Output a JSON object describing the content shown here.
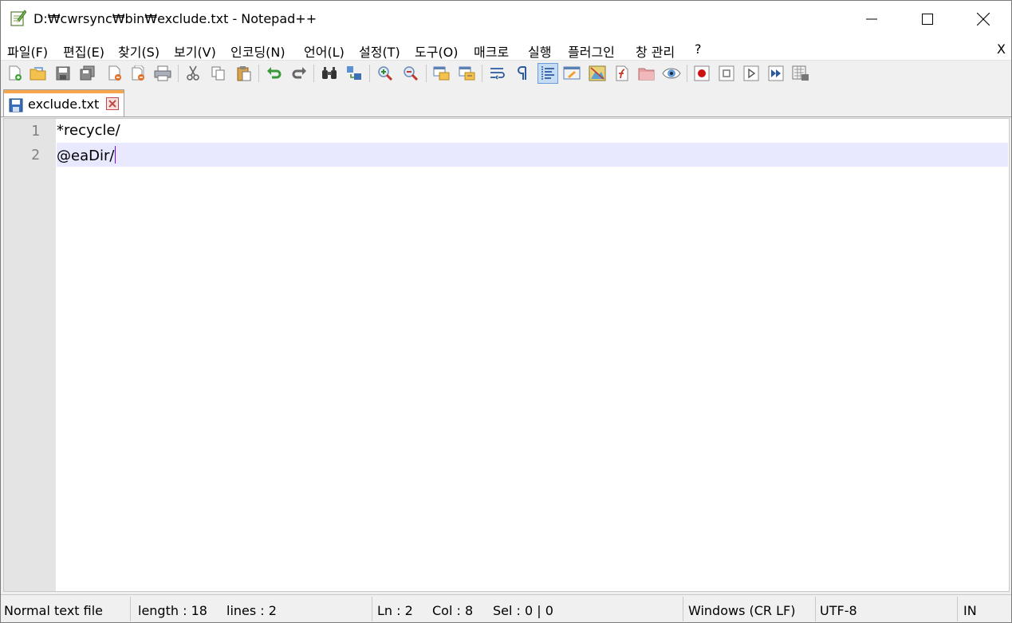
{
  "window": {
    "title": "D:₩cwrsync₩bin₩exclude.txt - Notepad++"
  },
  "menu": {
    "items": [
      "파일(F)",
      "편집(E)",
      "찾기(S)",
      "보기(V)",
      "인코딩(N)",
      "언어(L)",
      "설정(T)",
      "도구(O)",
      "매크로",
      "실행",
      "플러그인",
      "창 관리",
      "?"
    ],
    "close_label": "X"
  },
  "toolbar": {
    "icons": [
      "new-file-icon",
      "open-file-icon",
      "save-icon",
      "save-all-icon",
      "close-icon",
      "close-all-icon",
      "print-icon",
      "cut-icon",
      "copy-icon",
      "paste-icon",
      "undo-icon",
      "redo-icon",
      "find-icon",
      "replace-icon",
      "zoom-in-icon",
      "zoom-out-icon",
      "sync-vertical-icon",
      "sync-horizontal-icon",
      "word-wrap-icon",
      "show-all-chars-icon",
      "indent-guide-icon",
      "user-defined-language-icon",
      "document-map-icon",
      "function-list-icon",
      "folder-as-workspace-icon",
      "monitoring-icon",
      "record-macro-icon",
      "stop-macro-icon",
      "play-macro-icon",
      "run-macro-multiple-icon",
      "save-macro-icon"
    ],
    "active_icon": "indent-guide-icon"
  },
  "tabs": [
    {
      "label": "exclude.txt",
      "active": true
    }
  ],
  "editor": {
    "lines": [
      {
        "number": "1",
        "text": "*recycle/"
      },
      {
        "number": "2",
        "text": "@eaDir/"
      }
    ],
    "current_line_color": "#e8e8ff",
    "caret_color": "#8000ff"
  },
  "status": {
    "file_type": "Normal text file",
    "length": "length : 18",
    "lines": "lines : 2",
    "ln": "Ln : 2",
    "col": "Col : 8",
    "sel": "Sel : 0 | 0",
    "eol": "Windows (CR LF)",
    "encoding": "UTF-8",
    "mode": "IN"
  },
  "colors": {
    "tab_accent": "#faa54b",
    "gutter": "#e4e4e4"
  }
}
